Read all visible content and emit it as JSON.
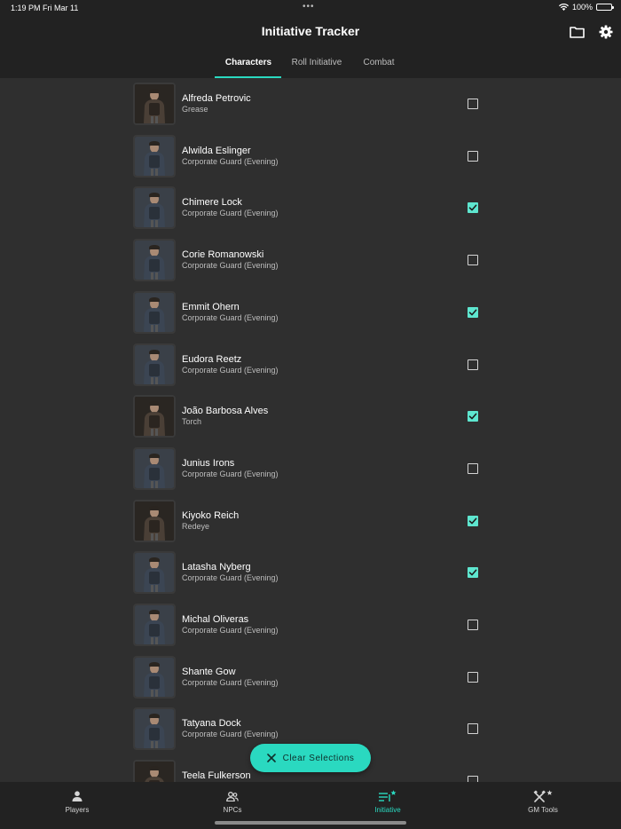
{
  "status_bar": {
    "time": "1:19 PM",
    "date": "Fri Mar 11",
    "battery": "100%"
  },
  "header": {
    "title": "Initiative Tracker"
  },
  "tabs": [
    {
      "label": "Characters",
      "active": true
    },
    {
      "label": "Roll Initiative",
      "active": false
    },
    {
      "label": "Combat",
      "active": false
    }
  ],
  "characters": [
    {
      "name": "Alfreda Petrovic",
      "role": "Grease",
      "checked": false
    },
    {
      "name": "Alwilda Eslinger",
      "role": "Corporate Guard (Evening)",
      "checked": false
    },
    {
      "name": "Chimere Lock",
      "role": "Corporate Guard (Evening)",
      "checked": true
    },
    {
      "name": "Corie Romanowski",
      "role": "Corporate Guard (Evening)",
      "checked": false
    },
    {
      "name": "Emmit Ohern",
      "role": "Corporate Guard (Evening)",
      "checked": true
    },
    {
      "name": "Eudora Reetz",
      "role": "Corporate Guard (Evening)",
      "checked": false
    },
    {
      "name": "João Barbosa Alves",
      "role": "Torch",
      "checked": true
    },
    {
      "name": "Junius Irons",
      "role": "Corporate Guard (Evening)",
      "checked": false
    },
    {
      "name": "Kiyoko Reich",
      "role": "Redeye",
      "checked": true
    },
    {
      "name": "Latasha Nyberg",
      "role": "Corporate Guard (Evening)",
      "checked": true
    },
    {
      "name": "Michal Oliveras",
      "role": "Corporate Guard (Evening)",
      "checked": false
    },
    {
      "name": "Shante Gow",
      "role": "Corporate Guard (Evening)",
      "checked": false
    },
    {
      "name": "Tatyana Dock",
      "role": "Corporate Guard (Evening)",
      "checked": false
    },
    {
      "name": "Teela Fulkerson",
      "role": "",
      "checked": false
    }
  ],
  "fab": {
    "label": "Clear Selections"
  },
  "bottom_nav": [
    {
      "label": "Players",
      "icon": "person-icon",
      "active": false
    },
    {
      "label": "NPCs",
      "icon": "group-icon",
      "active": false
    },
    {
      "label": "Initiative",
      "icon": "initiative-list-icon",
      "active": true
    },
    {
      "label": "GM Tools",
      "icon": "tools-icon",
      "active": false
    }
  ],
  "colors": {
    "accent": "#2ad9c0",
    "background": "#2f2f2f",
    "bar": "#222222"
  }
}
